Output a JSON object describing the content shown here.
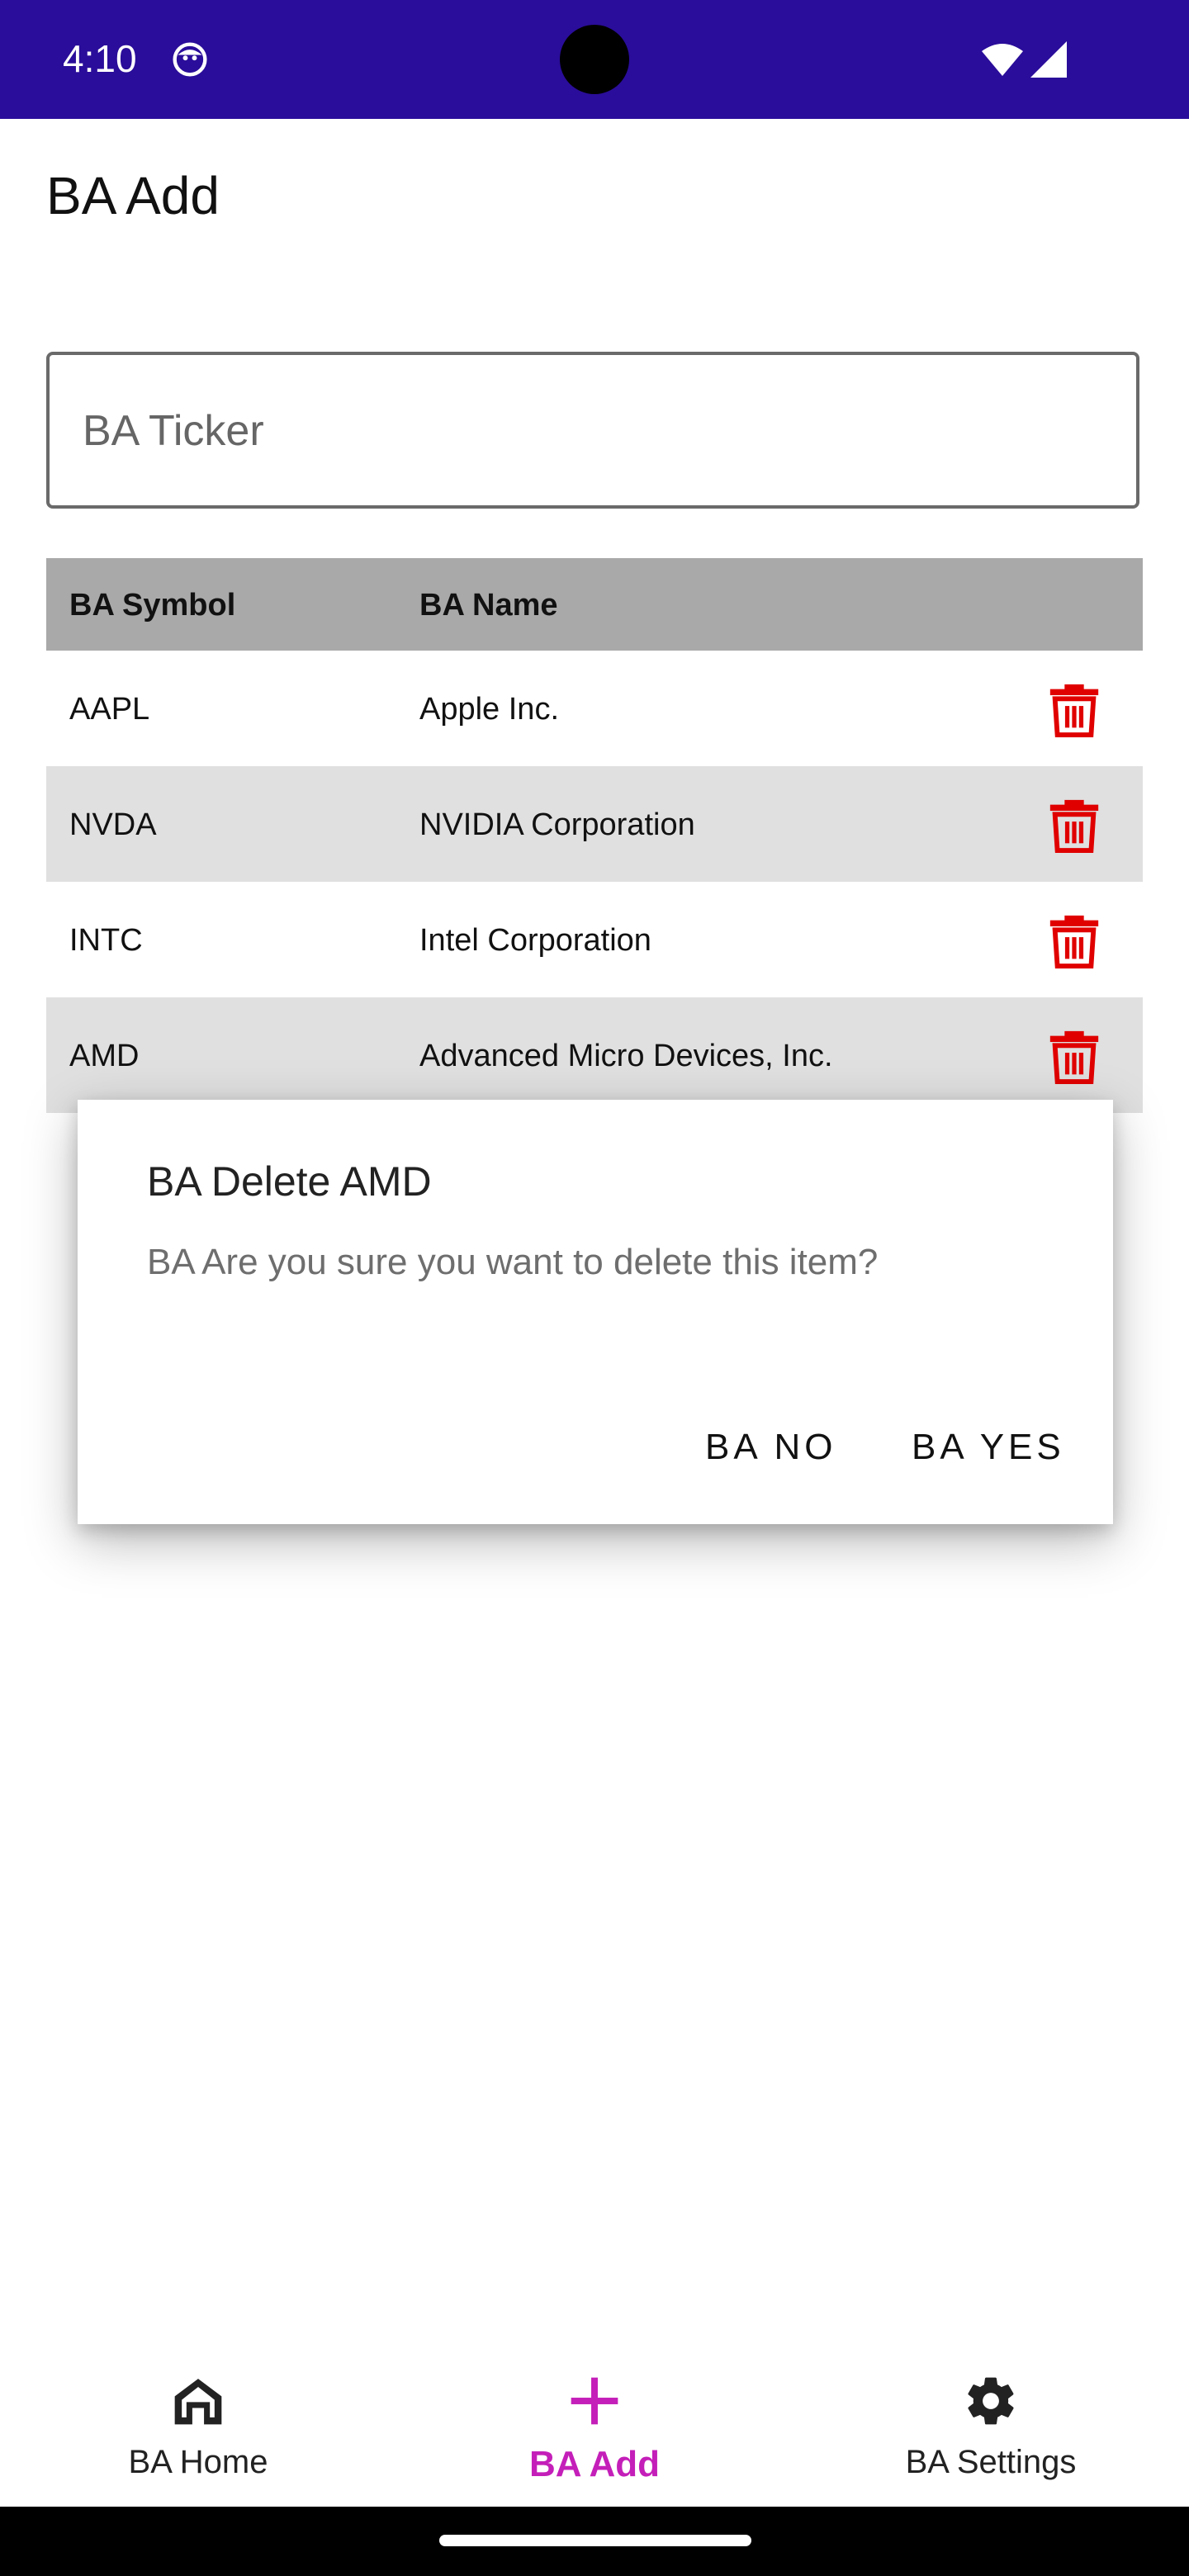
{
  "status_bar": {
    "time": "4:10",
    "background": "#2a0d9a",
    "icons": [
      "app-notification-icon",
      "wifi-icon",
      "signal-icon"
    ]
  },
  "page": {
    "title": "BA Add"
  },
  "ticker_input": {
    "value": "",
    "placeholder": "BA Ticker"
  },
  "table": {
    "headers": {
      "symbol": "BA Symbol",
      "name": "BA Name"
    },
    "rows": [
      {
        "symbol": "AAPL",
        "name": "Apple Inc.",
        "action_icon": "trash-icon"
      },
      {
        "symbol": "NVDA",
        "name": "NVIDIA Corporation",
        "action_icon": "trash-icon"
      },
      {
        "symbol": "INTC",
        "name": "Intel Corporation",
        "action_icon": "trash-icon"
      },
      {
        "symbol": "AMD",
        "name": "Advanced Micro Devices, Inc.",
        "action_icon": "trash-icon"
      }
    ],
    "header_background": "#a9a9a9",
    "alt_row_background": "#e0e0e0",
    "delete_color": "#e00000"
  },
  "dialog": {
    "title": "BA Delete AMD",
    "message": "BA Are you sure you want to delete this item?",
    "negative_label": "BA NO",
    "positive_label": "BA YES"
  },
  "bottom_nav": {
    "items": [
      {
        "label": "BA Home",
        "icon": "home-icon",
        "selected": false
      },
      {
        "label": "BA Add",
        "icon": "plus-icon",
        "selected": true
      },
      {
        "label": "BA Settings",
        "icon": "gear-icon",
        "selected": false
      }
    ],
    "accent": "#c41fb9"
  }
}
